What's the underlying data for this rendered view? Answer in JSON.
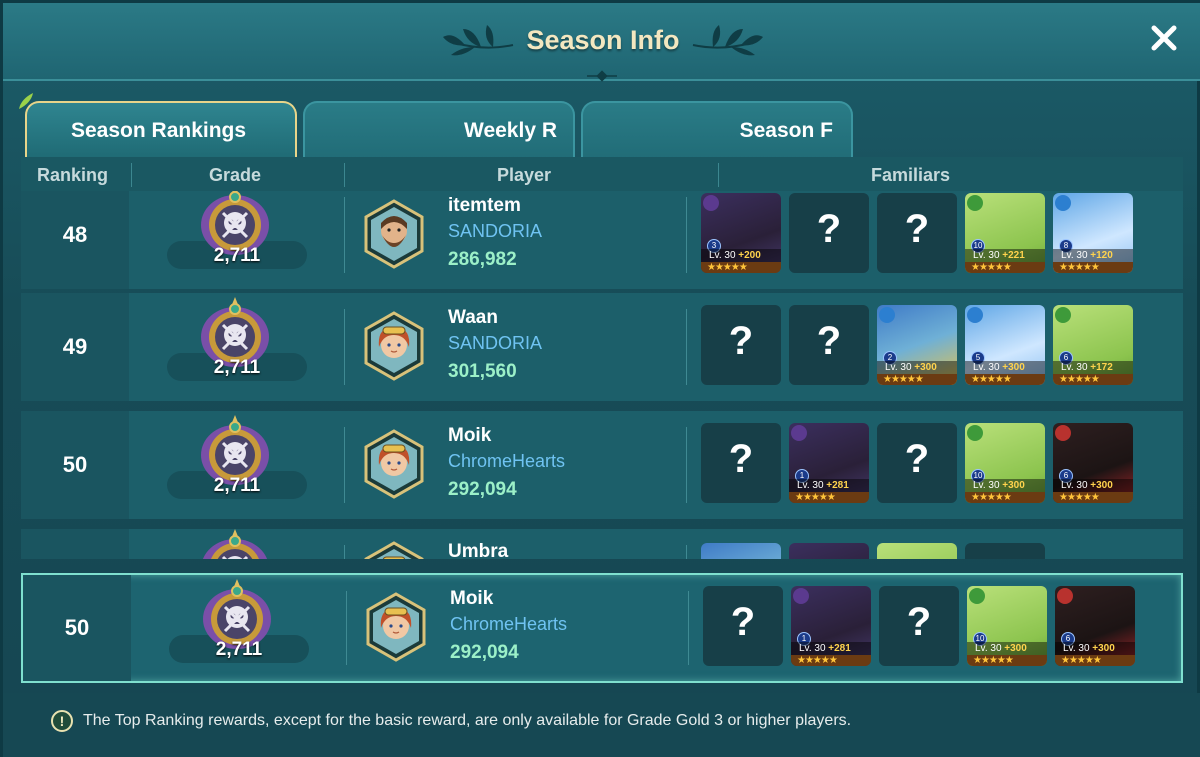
{
  "header": {
    "title": "Season Info",
    "close_icon": "close-icon"
  },
  "tabs": [
    {
      "label": "Season Rankings",
      "active": true
    },
    {
      "label": "Weekly R",
      "active": false
    },
    {
      "label": "Season F",
      "active": false
    }
  ],
  "columns": {
    "ranking": "Ranking",
    "grade": "Grade",
    "player": "Player",
    "familiars": "Familiars"
  },
  "rows": [
    {
      "rank": "48",
      "grade_score": "2,711",
      "name": "itemtem",
      "guild": "SANDORIA",
      "power": "286,982",
      "avatar": "bearded-man",
      "familiars": [
        {
          "known": true,
          "creature": "dark-bull",
          "element": "dark",
          "stars_rank": "3",
          "level": "Lv. 30",
          "bonus": "+200"
        },
        {
          "known": false
        },
        {
          "known": false
        },
        {
          "known": true,
          "creature": "green-sprout",
          "element": "wood",
          "stars_rank": "10",
          "level": "Lv. 30",
          "bonus": "+221"
        },
        {
          "known": true,
          "creature": "water-puff",
          "element": "water",
          "stars_rank": "8",
          "level": "Lv. 30",
          "bonus": "+120"
        }
      ]
    },
    {
      "rank": "49",
      "grade_score": "2,711",
      "name": "Waan",
      "guild": "SANDORIA",
      "power": "301,560",
      "avatar": "goggle-girl",
      "familiars": [
        {
          "known": false
        },
        {
          "known": false
        },
        {
          "known": true,
          "creature": "water-dragon",
          "element": "water",
          "stars_rank": "2",
          "level": "Lv. 30",
          "bonus": "+300"
        },
        {
          "known": true,
          "creature": "water-puff",
          "element": "water",
          "stars_rank": "5",
          "level": "Lv. 30",
          "bonus": "+300"
        },
        {
          "known": true,
          "creature": "green-sprout",
          "element": "wood",
          "stars_rank": "6",
          "level": "Lv. 30",
          "bonus": "+172"
        }
      ]
    },
    {
      "rank": "50",
      "grade_score": "2,711",
      "name": "Moik",
      "guild": "ChromeHearts",
      "power": "292,094",
      "avatar": "goggle-girl",
      "familiars": [
        {
          "known": false
        },
        {
          "known": true,
          "creature": "dark-bull",
          "element": "dark",
          "stars_rank": "1",
          "level": "Lv. 30",
          "bonus": "+281"
        },
        {
          "known": false
        },
        {
          "known": true,
          "creature": "green-sprout",
          "element": "wood",
          "stars_rank": "10",
          "level": "Lv. 30",
          "bonus": "+300"
        },
        {
          "known": true,
          "creature": "fire-cat",
          "element": "fire",
          "stars_rank": "6",
          "level": "Lv. 30",
          "bonus": "+300"
        }
      ]
    },
    {
      "rank": "",
      "grade_score": "",
      "name": "Umbra",
      "guild": "",
      "power": "",
      "avatar": "partial",
      "familiars": []
    }
  ],
  "my_row": {
    "rank": "50",
    "grade_score": "2,711",
    "name": "Moik",
    "guild": "ChromeHearts",
    "power": "292,094",
    "avatar": "goggle-girl",
    "familiars": [
      {
        "known": false
      },
      {
        "known": true,
        "creature": "dark-bull",
        "element": "dark",
        "stars_rank": "1",
        "level": "Lv. 30",
        "bonus": "+281"
      },
      {
        "known": false
      },
      {
        "known": true,
        "creature": "green-sprout",
        "element": "wood",
        "stars_rank": "10",
        "level": "Lv. 30",
        "bonus": "+300"
      },
      {
        "known": true,
        "creature": "fire-cat",
        "element": "fire",
        "stars_rank": "6",
        "level": "Lv. 30",
        "bonus": "+300"
      }
    ]
  },
  "unknown_mark": "?",
  "star_row": "★★★★★",
  "footer": {
    "notice_icon": "!",
    "notice": "The Top Ranking rewards, except for the basic reward, are only available for Grade Gold 3 or higher players."
  },
  "colors": {
    "accent_gold": "#e8d58a",
    "guild_blue": "#6fc3f2",
    "power_green": "#9cf0c8",
    "highlight_border": "#7fe0cf"
  }
}
